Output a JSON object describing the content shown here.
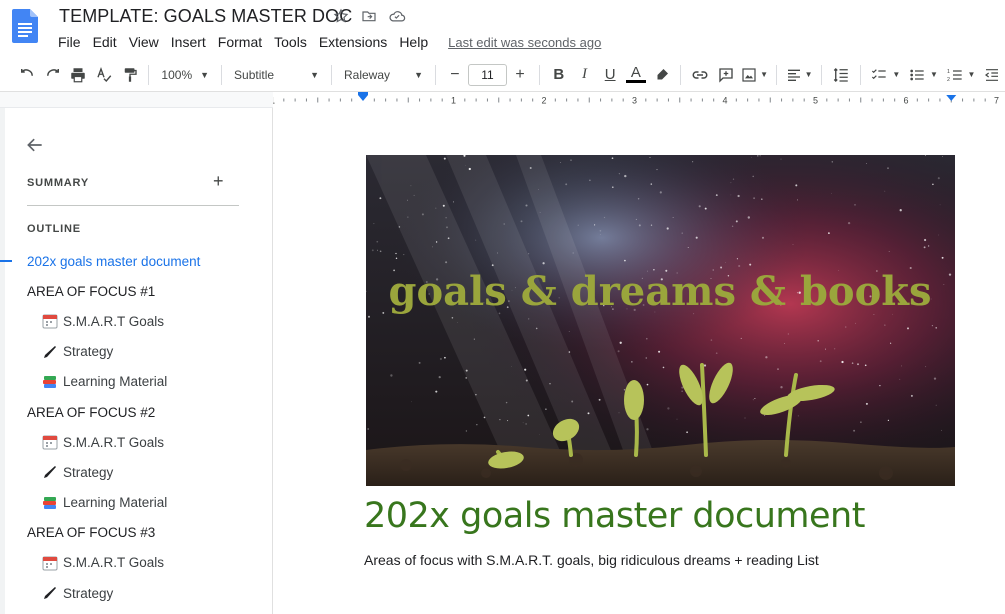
{
  "app": {
    "title": "TEMPLATE: GOALS MASTER DOC",
    "menu": [
      "File",
      "Edit",
      "View",
      "Insert",
      "Format",
      "Tools",
      "Extensions",
      "Help"
    ],
    "last_edit": "Last edit was seconds ago"
  },
  "toolbar": {
    "zoom": "100%",
    "style": "Subtitle",
    "font": "Raleway",
    "font_size": "11",
    "minus": "−",
    "plus": "+",
    "bold": "B",
    "italic": "I",
    "underline": "U",
    "text_color": "A"
  },
  "ruler": {
    "labels": [
      "1",
      "1",
      "2",
      "3",
      "4",
      "5",
      "6",
      "7"
    ]
  },
  "sidebar": {
    "summary_label": "SUMMARY",
    "summary_add": "+",
    "outline_label": "OUTLINE",
    "items": [
      {
        "label": "202x goals master document",
        "level": 1,
        "active": true,
        "icon": ""
      },
      {
        "label": "AREA OF FOCUS #1",
        "level": 1,
        "icon": ""
      },
      {
        "label": "S.M.A.R.T Goals",
        "level": 2,
        "icon": "calendar-icon"
      },
      {
        "label": "Strategy",
        "level": 2,
        "icon": "pen-icon"
      },
      {
        "label": "Learning Material",
        "level": 2,
        "icon": "books-icon"
      },
      {
        "label": "AREA OF FOCUS #2",
        "level": 1,
        "icon": ""
      },
      {
        "label": "S.M.A.R.T Goals",
        "level": 2,
        "icon": "calendar-icon"
      },
      {
        "label": "Strategy",
        "level": 2,
        "icon": "pen-icon"
      },
      {
        "label": "Learning Material",
        "level": 2,
        "icon": "books-icon"
      },
      {
        "label": "AREA OF FOCUS #3",
        "level": 1,
        "icon": ""
      },
      {
        "label": "S.M.A.R.T Goals",
        "level": 2,
        "icon": "calendar-icon"
      },
      {
        "label": "Strategy",
        "level": 2,
        "icon": "pen-icon"
      }
    ]
  },
  "document": {
    "banner_text": "goals & dreams & books",
    "heading": "202x goals master document",
    "subtitle": "Areas of focus with S.M.A.R.T. goals, big ridiculous dreams + reading List"
  },
  "colors": {
    "accent_blue": "#1a73e8",
    "heading_green": "#38761d",
    "banner_text": "#9aa53c"
  }
}
